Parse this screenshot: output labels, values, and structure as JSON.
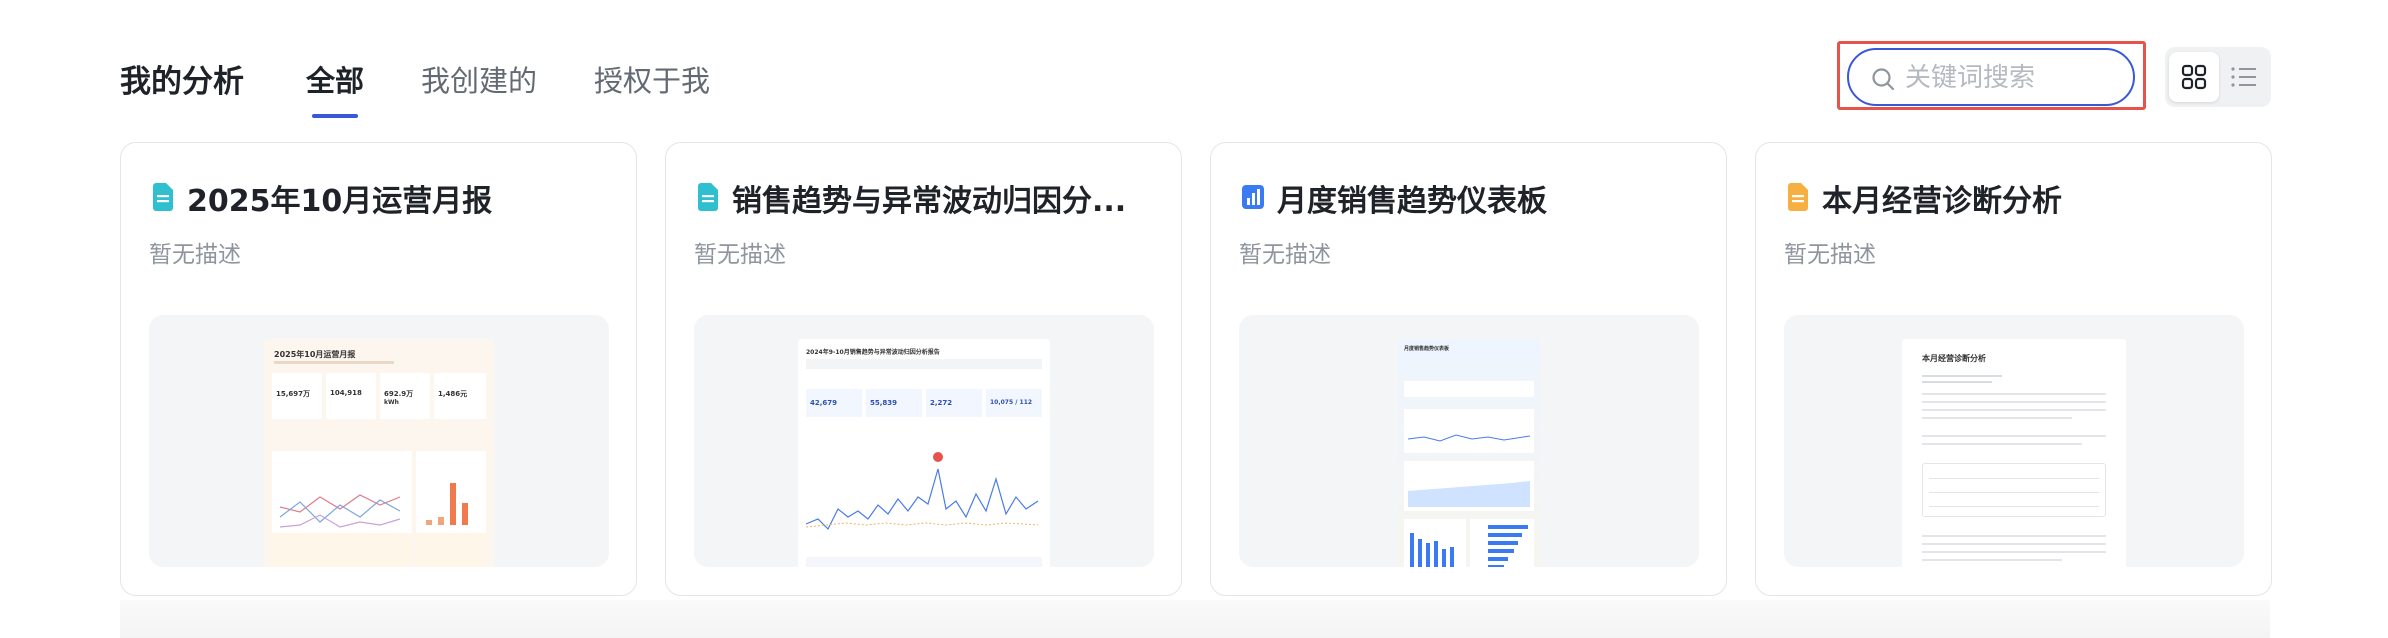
{
  "header": {
    "title": "我的分析",
    "tabs": [
      {
        "label": "全部",
        "active": true
      },
      {
        "label": "我创建的",
        "active": false
      },
      {
        "label": "授权于我",
        "active": false
      }
    ]
  },
  "search": {
    "placeholder": "关键词搜索",
    "value": "",
    "icon": "search-icon"
  },
  "view_toggle": {
    "grid_icon": "grid-view-icon",
    "list_icon": "list-view-icon",
    "active": "grid"
  },
  "colors": {
    "accent": "#3a57d8",
    "highlight": "#e5534b"
  },
  "cards": [
    {
      "title": "2025年10月运营月报",
      "description": "暂无描述",
      "icon": "document-icon",
      "icon_color": "#2fbfcf",
      "preview": {
        "heading": "2025年10月运营月报",
        "kpis": [
          "15,697万",
          "104,918",
          "692.9万",
          "1,486元"
        ],
        "kpi_sub": "kWh"
      }
    },
    {
      "title": "销售趋势与异常波动归因分...",
      "description": "暂无描述",
      "icon": "document-icon",
      "icon_color": "#2fbfcf",
      "preview": {
        "heading": "2024年9-10月销售趋势与异常波动归因分析报告",
        "kpis": [
          "42,679",
          "55,839",
          "2,272",
          "10,075 / 112"
        ]
      }
    },
    {
      "title": "月度销售趋势仪表板",
      "description": "暂无描述",
      "icon": "bar-chart-icon",
      "icon_color": "#3a7af2",
      "preview": {
        "heading": "月度销售趋势仪表板"
      }
    },
    {
      "title": "本月经营诊断分析",
      "description": "暂无描述",
      "icon": "document-icon",
      "icon_color": "#f5b041",
      "preview": {
        "heading": "本月经营诊断分析"
      }
    }
  ]
}
